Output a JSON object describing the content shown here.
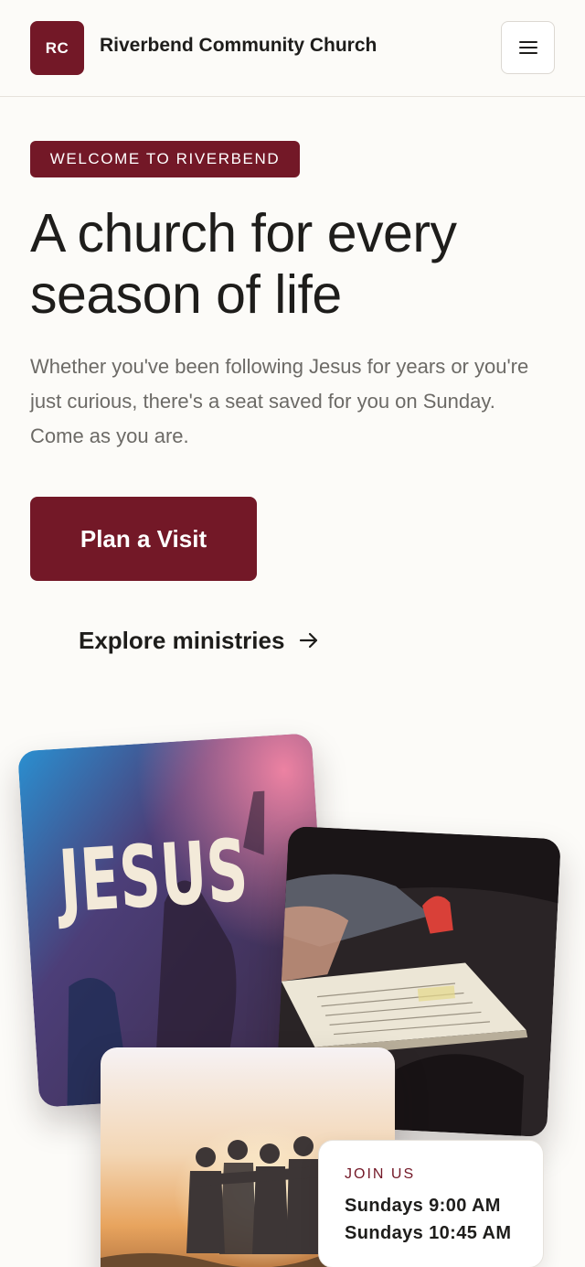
{
  "header": {
    "logo_initials": "RC",
    "site_name": "Riverbend Community Church",
    "menu_icon": "hamburger-menu-icon"
  },
  "hero": {
    "eyebrow": "WELCOME TO RIVERBEND",
    "headline_line1": "A church for every",
    "headline_line2": "season of life",
    "lede": "Whether you've been following Jesus for years or you're just curious, there's a seat saved for you on Sunday. Come as you are.",
    "primary_cta": "Plan a Visit",
    "secondary_cta": "Explore ministries",
    "secondary_cta_icon": "arrow-right-icon"
  },
  "gallery": {
    "worship_photo_word": "JESUS",
    "join_card": {
      "label": "JOIN US",
      "times": [
        "Sundays 9:00 AM",
        "Sundays 10:45 AM"
      ]
    }
  },
  "colors": {
    "brand": "#731827",
    "background": "#fcfbf8",
    "text": "#1e1d1b",
    "muted_text": "#6c6a66"
  }
}
